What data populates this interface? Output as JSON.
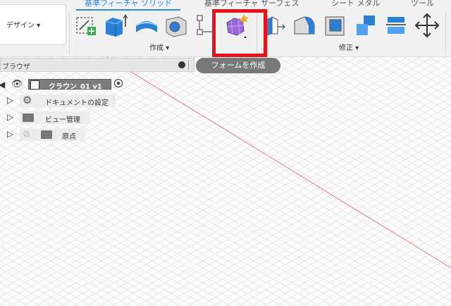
{
  "toolbar": {
    "tabs": [
      "基準フィーチャ ソリッド",
      "基準フィーチャ サーフェス",
      "シート メタル",
      "ツール"
    ],
    "design_label": "デザイン ▾",
    "create_label": "作成 ▾",
    "modify_label": "修正 ▾",
    "tooltip": "フォームを作成"
  },
  "browser": {
    "title": "ブラウザ",
    "root_label": "クラウン_01 v1",
    "items": [
      "ドキュメントの設定",
      "ビュー管理",
      "原点"
    ]
  },
  "colors": {
    "accent": "#2a8bd8",
    "highlight": "#e8131a",
    "axis": "#e06060"
  }
}
